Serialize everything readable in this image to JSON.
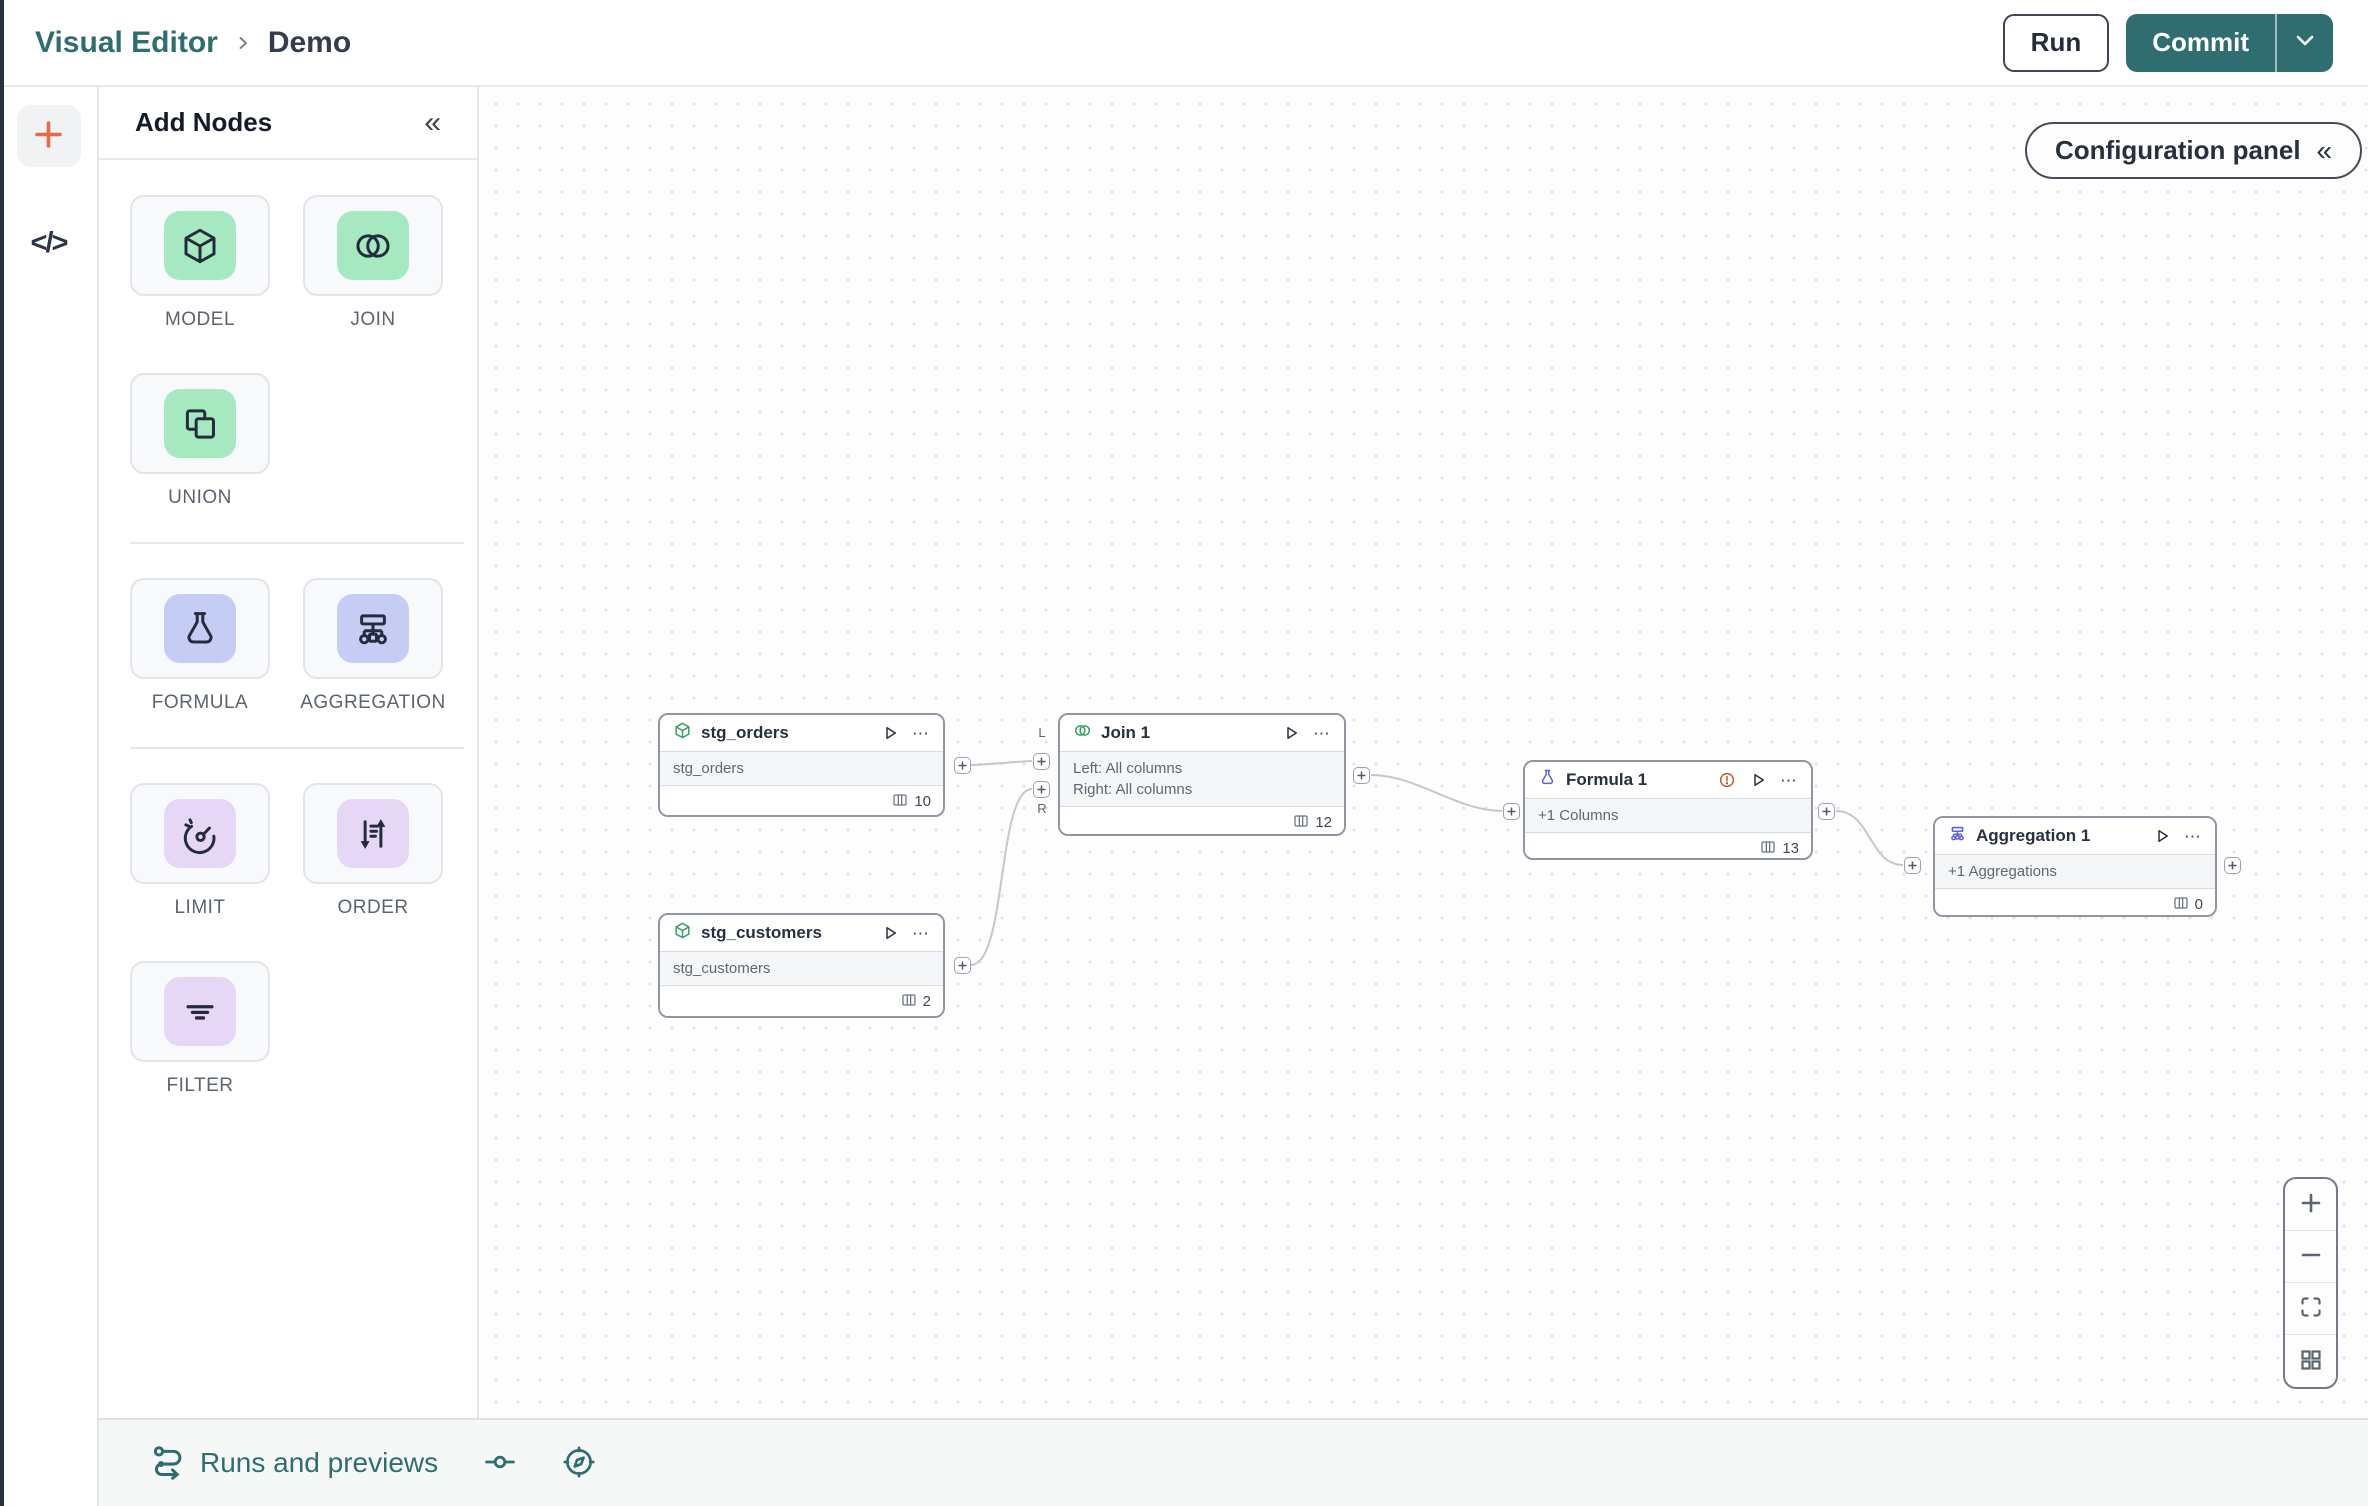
{
  "header": {
    "breadcrumb": {
      "section": "Visual Editor",
      "page": "Demo"
    },
    "run_button": "Run",
    "commit_button": "Commit"
  },
  "icons": {
    "collapse": "«",
    "ellipsis": "⋯",
    "code": "</>"
  },
  "add_nodes": {
    "title": "Add Nodes",
    "groups": [
      {
        "tiles": [
          {
            "label": "MODEL"
          },
          {
            "label": "JOIN"
          },
          {
            "label": "UNION"
          }
        ]
      },
      {
        "tiles": [
          {
            "label": "FORMULA"
          },
          {
            "label": "AGGREGATION"
          }
        ]
      },
      {
        "tiles": [
          {
            "label": "LIMIT"
          },
          {
            "label": "ORDER"
          },
          {
            "label": "FILTER"
          }
        ]
      }
    ]
  },
  "canvas": {
    "config_button": "Configuration panel",
    "join_handles": {
      "left": "L",
      "right": "R"
    },
    "nodes": [
      {
        "title": "stg_orders",
        "body": "stg_orders",
        "columns": "10"
      },
      {
        "title": "stg_customers",
        "body": "stg_customers",
        "columns": "2"
      },
      {
        "title": "Join 1",
        "body_line1": "Left: All columns",
        "body_line2": "Right: All columns",
        "columns": "12"
      },
      {
        "title": "Formula 1",
        "body": "+1 Columns",
        "columns": "13"
      },
      {
        "title": "Aggregation 1",
        "body": "+1 Aggregations",
        "columns": "0"
      }
    ]
  },
  "bottom_bar": {
    "runs_label": "Runs and previews"
  },
  "colors": {
    "teal": "#2f6d70",
    "orange_accent": "#e8694a",
    "green_node_icon": "#35a061",
    "indigo_node_icon": "#5f61d9",
    "warning": "#b95c28",
    "green_tile_bg": "#a6e8c0",
    "periwinkle_tile_bg": "#c6cdf4",
    "purple_tile_bg": "#e7d7f7"
  }
}
